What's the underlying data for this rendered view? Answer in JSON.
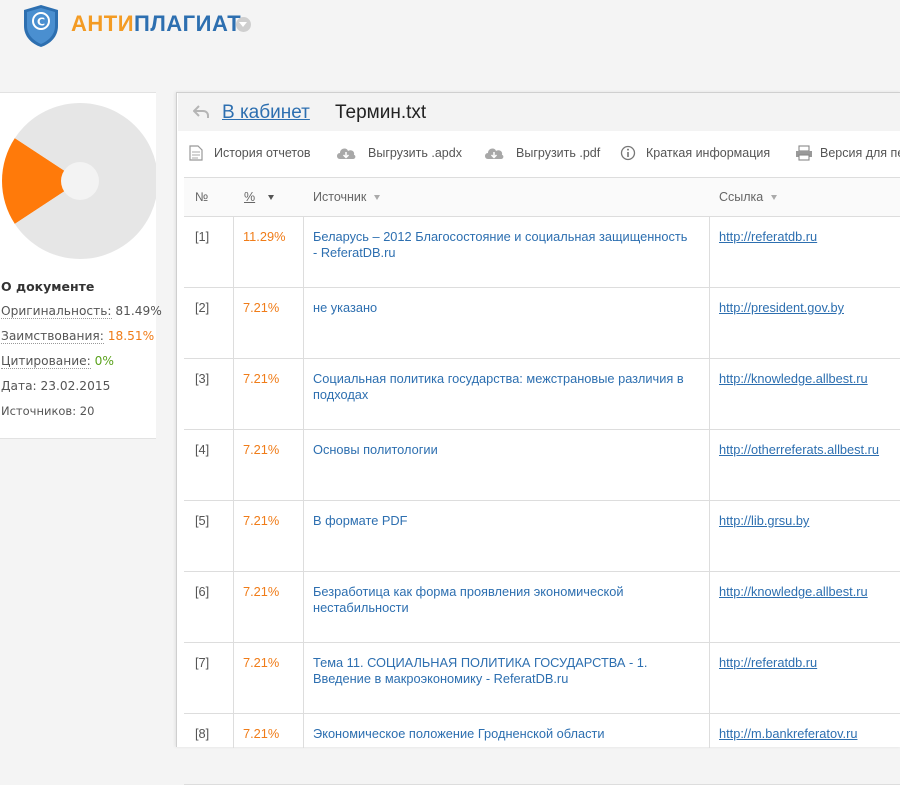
{
  "brand": {
    "part1": "АНТИ",
    "part2": "ПЛАГИАТ"
  },
  "colors": {
    "accent_orange": "#f07c18",
    "link_blue": "#2d6fb0",
    "green": "#5aa21c",
    "pie_gray": "#e6e6e6"
  },
  "pie": {
    "borrowed_fraction": 0.1851,
    "original_fraction": 0.8149
  },
  "document_info": {
    "title": "О документе",
    "originality_label": "Оригинальность:",
    "originality_value": "81.49%",
    "borrowing_label": "Заимствования:",
    "borrowing_value": "18.51%",
    "citation_label": "Цитирование:",
    "citation_value": "0%",
    "date_label": "Дата:",
    "date_value": "23.02.2015",
    "sources_label": "Источников:",
    "sources_value": "20"
  },
  "header": {
    "back_link": "В кабинет",
    "document_title": "Термин.txt"
  },
  "toolbar": {
    "history": "История отчетов",
    "export_apdx": "Выгрузить .apdx",
    "export_pdf": "Выгрузить .pdf",
    "brief_info": "Краткая информация",
    "print_version": "Версия для печати"
  },
  "table": {
    "columns": {
      "num": "№",
      "pct": "%",
      "source": "Источник",
      "link": "Ссылка"
    },
    "rows": [
      {
        "num": "[1]",
        "pct": "11.29%",
        "source": "Беларусь – 2012 Благосостояние и социальная защищенность - ReferatDB.ru",
        "link": "http://referatdb.ru"
      },
      {
        "num": "[2]",
        "pct": "7.21%",
        "source": "не указано",
        "link": "http://president.gov.by"
      },
      {
        "num": "[3]",
        "pct": "7.21%",
        "source": "Социальная политика государства: межстрановые различия в подходах",
        "link": "http://knowledge.allbest.ru"
      },
      {
        "num": "[4]",
        "pct": "7.21%",
        "source": "Основы политологии",
        "link": "http://otherreferats.allbest.ru"
      },
      {
        "num": "[5]",
        "pct": "7.21%",
        "source": "В формате PDF",
        "link": "http://lib.grsu.by"
      },
      {
        "num": "[6]",
        "pct": "7.21%",
        "source": "Безработица как форма проявления экономической нестабильности",
        "link": "http://knowledge.allbest.ru"
      },
      {
        "num": "[7]",
        "pct": "7.21%",
        "source": "Тема 11. СОЦИАЛЬНАЯ ПОЛИТИКА ГОСУДАРСТВА - 1. Введение в макроэкономику - ReferatDB.ru",
        "link": "http://referatdb.ru"
      },
      {
        "num": "[8]",
        "pct": "7.21%",
        "source": "Экономическое положение Гродненской области",
        "link": "http://m.bankreferatov.ru"
      }
    ]
  }
}
